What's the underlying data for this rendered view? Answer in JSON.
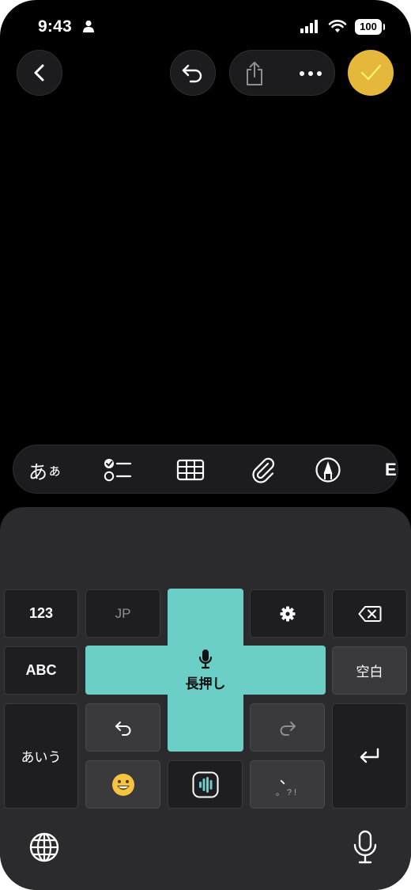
{
  "status_bar": {
    "time": "9:43",
    "battery": "100",
    "icons": [
      "person-icon",
      "signal-icon",
      "wifi-icon",
      "battery-icon"
    ]
  },
  "nav": {
    "icons": [
      "chevron-left-icon",
      "undo-icon",
      "share-icon",
      "more-icon",
      "checkmark-icon"
    ],
    "done_color": "#e5b73b"
  },
  "toolbar": {
    "text_style_label_big": "あ",
    "text_style_label_small": "ぁ",
    "edge_label": "E",
    "icons": [
      "checklist-icon",
      "table-icon",
      "paperclip-icon",
      "markup-pen-icon"
    ]
  },
  "keyboard": {
    "key_123": "123",
    "key_jp": "JP",
    "key_abc": "ABC",
    "key_space": "空白",
    "key_aiu": "あいう",
    "punct_main": "、",
    "punct_sub": "。?!",
    "voice_hint": "長押し",
    "accent_color": "#6bcfc7",
    "icons": [
      "gear-icon",
      "delete-icon",
      "undo-icon",
      "redo-icon",
      "return-icon",
      "emoji-icon",
      "voice-wave-icon",
      "microphone-icon",
      "globe-icon"
    ]
  }
}
